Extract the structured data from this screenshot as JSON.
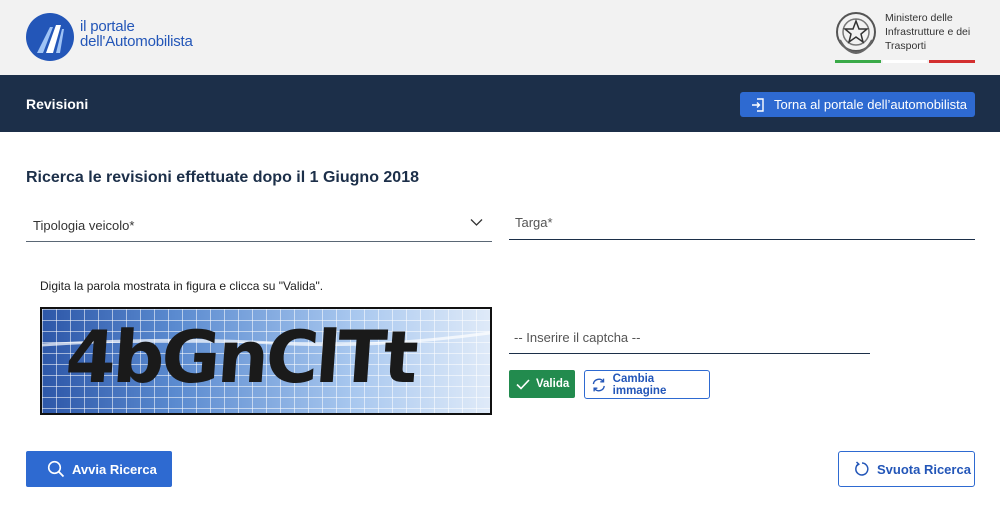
{
  "header": {
    "logo_line1": "il portale",
    "logo_line2": "dell'Automobilista",
    "ministry_line1": "Ministero delle",
    "ministry_line2": "Infrastrutture e dei",
    "ministry_line3": "Trasporti",
    "icons": {
      "logo": "road-logo-icon",
      "emblem": "italian-republic-emblem-icon"
    }
  },
  "nav": {
    "title": "Revisioni",
    "back_label": "Torna al portale dell’automobilista",
    "back_icon": "enter-icon"
  },
  "main": {
    "section_title": "Ricerca le revisioni effettuate dopo il 1 Giugno 2018",
    "vehicle_type_label": "Tipologia veicolo*",
    "plate_placeholder": "Targa*",
    "captcha_instruction": "Digita la parola mostrata in figura e clicca su \"Valida\".",
    "captcha_image_text": "4bGnClTt",
    "captcha_placeholder": "-- Inserire il captcha --",
    "validate_label": "Valida",
    "change_image_label": "Cambia immagine",
    "search_label": "Avvia Ricerca",
    "reset_label": "Svuota Ricerca"
  },
  "colors": {
    "primary": "#2e6ad1",
    "navbar": "#1c2f49",
    "success": "#228b4e",
    "header_bg": "#f2f2f2"
  }
}
